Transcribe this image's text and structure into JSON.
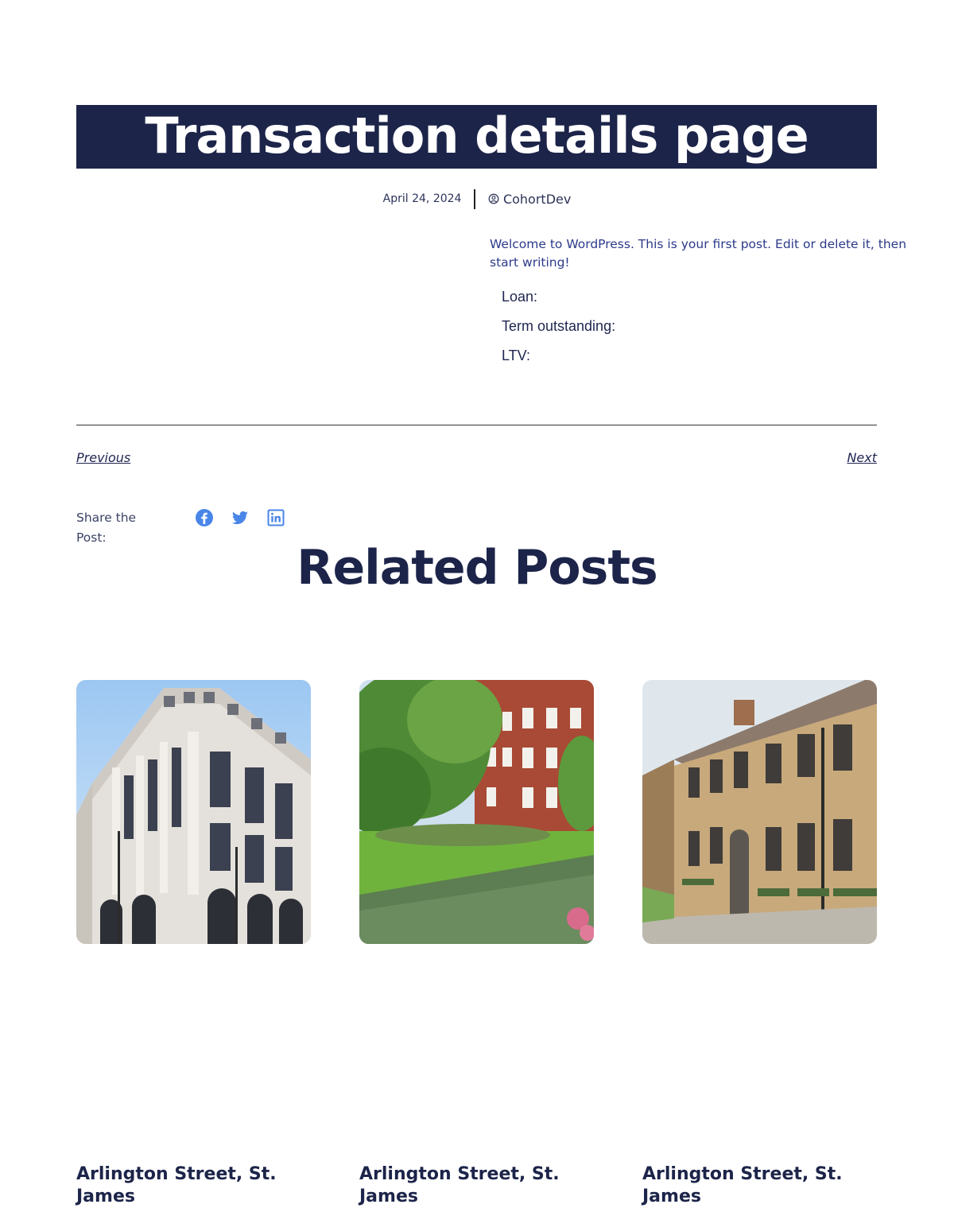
{
  "post": {
    "title": "Transaction details page",
    "date": "April 24, 2024",
    "author": "CohortDev",
    "excerpt": "Welcome to WordPress. This is your first post. Edit or delete it, then start writing!",
    "facts": [
      {
        "label": "Loan:"
      },
      {
        "label": "Term outstanding:"
      },
      {
        "label": "LTV:"
      }
    ]
  },
  "navigation": {
    "previous": "Previous",
    "next": "Next"
  },
  "share": {
    "label": "Share the Post:",
    "icons": [
      "facebook-icon",
      "twitter-icon",
      "linkedin-icon"
    ],
    "icon_color": "#4a86e8"
  },
  "related": {
    "heading": "Related Posts",
    "posts": [
      {
        "title": "Arlington Street, St. James",
        "image": "stone-office-building"
      },
      {
        "title": "Arlington Street, St. James",
        "image": "red-brick-garden-building"
      },
      {
        "title": "Arlington Street, St. James",
        "image": "yellow-brick-mews-house"
      }
    ]
  },
  "colors": {
    "primary": "#1c2449",
    "text": "#1f2550",
    "link_blue": "#2c3a8a",
    "background": "#ffffff"
  }
}
